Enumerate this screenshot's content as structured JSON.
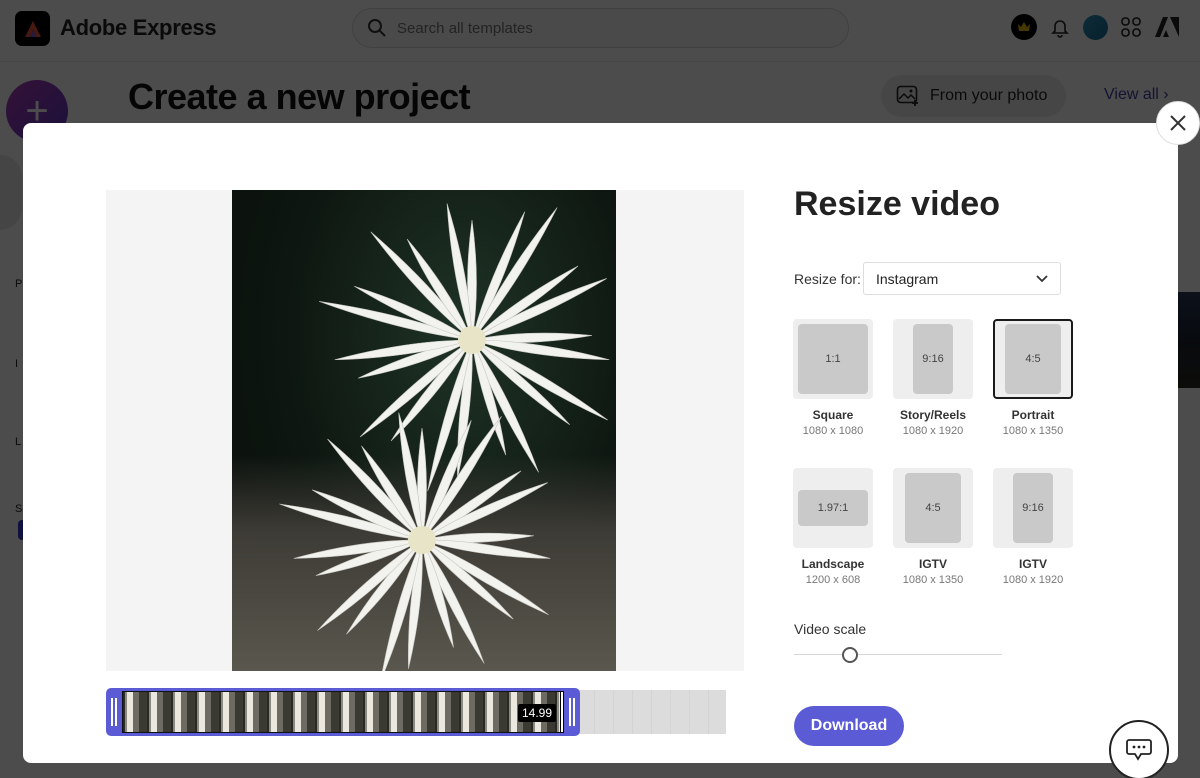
{
  "app": {
    "brand": "Adobe Express",
    "search_placeholder": "Search all templates",
    "page_title": "Create a new project",
    "from_photo_label": "From your photo",
    "view_all_label": "View all",
    "sidebar_partial_labels": [
      "P",
      "I",
      "L",
      "S"
    ]
  },
  "modal": {
    "title": "Resize video",
    "resize_for_label": "Resize for:",
    "resize_for_value": "Instagram",
    "options": [
      {
        "ratio": "1:1",
        "name": "Square",
        "dims": "1080 x 1080",
        "selected": false
      },
      {
        "ratio": "9:16",
        "name": "Story/Reels",
        "dims": "1080 x 1920",
        "selected": false
      },
      {
        "ratio": "4:5",
        "name": "Portrait",
        "dims": "1080 x 1350",
        "selected": true
      },
      {
        "ratio": "1.97:1",
        "name": "Landscape",
        "dims": "1200 x 608",
        "selected": false
      },
      {
        "ratio": "4:5",
        "name": "IGTV",
        "dims": "1080 x 1350",
        "selected": false
      },
      {
        "ratio": "9:16",
        "name": "IGTV",
        "dims": "1080 x 1920",
        "selected": false
      }
    ],
    "video_scale_label": "Video scale",
    "video_scale_value": 0.25,
    "download_label": "Download",
    "timeline_time": "14.99",
    "accent_color": "#5b5bd6"
  }
}
